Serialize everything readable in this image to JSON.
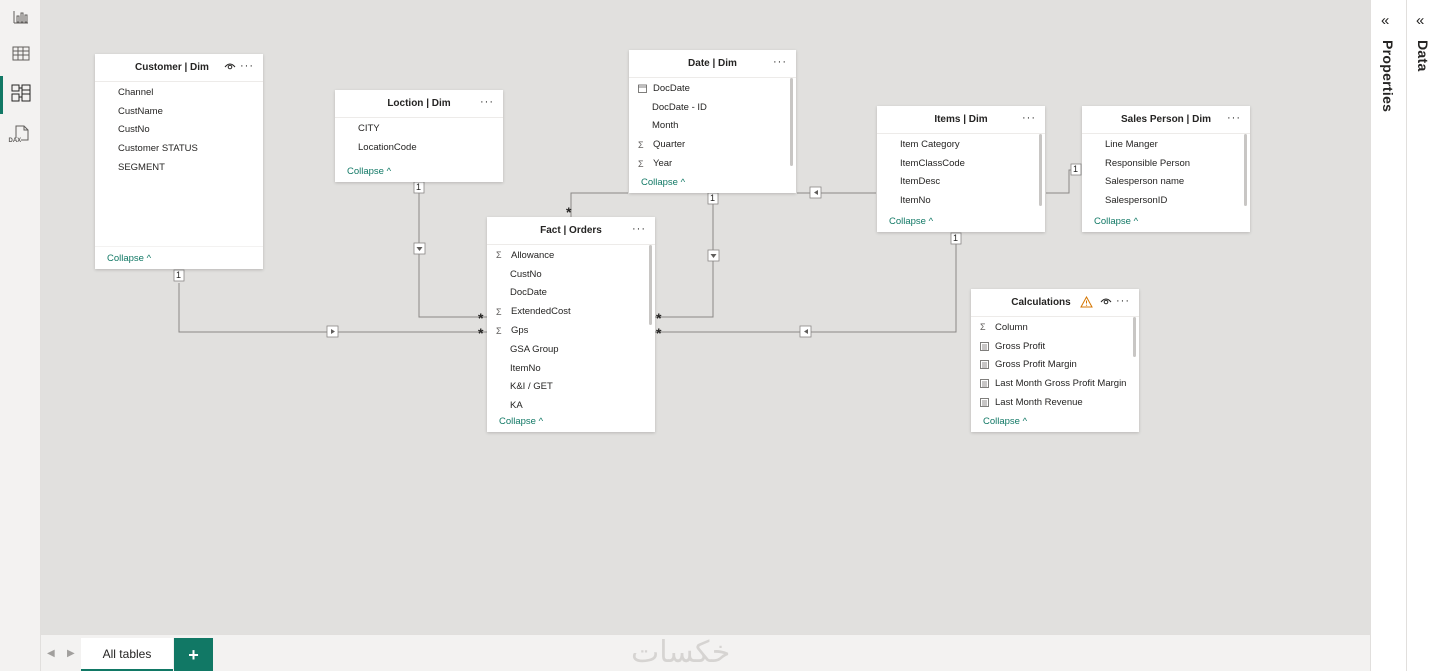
{
  "rail": {
    "items": [
      {
        "icon": "report-view-icon"
      },
      {
        "icon": "table-view-icon"
      },
      {
        "icon": "model-view-icon"
      },
      {
        "icon": "dax-query-view-icon",
        "label": "DAX"
      }
    ]
  },
  "tables": {
    "customer": {
      "title": "Customer | Dim",
      "fields": [
        "Channel",
        "CustName",
        "CustNo",
        "Customer STATUS",
        "SEGMENT"
      ],
      "collapse": "Collapse"
    },
    "location": {
      "title": "Loction | Dim",
      "fields": [
        "CITY",
        "LocationCode"
      ],
      "collapse": "Collapse"
    },
    "date": {
      "title": "Date | Dim",
      "fields": [
        {
          "icon": "calendar",
          "name": "DocDate"
        },
        {
          "icon": "",
          "name": "DocDate - ID"
        },
        {
          "icon": "",
          "name": "Month"
        },
        {
          "icon": "sigma",
          "name": "Quarter"
        },
        {
          "icon": "sigma",
          "name": "Year"
        }
      ],
      "collapse": "Collapse"
    },
    "items": {
      "title": "Items | Dim",
      "fields": [
        "Item Category",
        "ItemClassCode",
        "ItemDesc",
        "ItemNo"
      ],
      "collapse": "Collapse"
    },
    "salesperson": {
      "title": "Sales Person | Dim",
      "fields": [
        "Line Manger",
        "Responsible Person",
        "Salesperson name",
        "SalespersonID"
      ],
      "collapse": "Collapse"
    },
    "fact": {
      "title": "Fact | Orders",
      "fields": [
        {
          "icon": "sigma",
          "name": "Allowance"
        },
        {
          "icon": "",
          "name": "CustNo"
        },
        {
          "icon": "",
          "name": "DocDate"
        },
        {
          "icon": "sigma",
          "name": "ExtendedCost"
        },
        {
          "icon": "sigma",
          "name": "Gps"
        },
        {
          "icon": "",
          "name": "GSA Group"
        },
        {
          "icon": "",
          "name": "ItemNo"
        },
        {
          "icon": "",
          "name": "K&I / GET"
        },
        {
          "icon": "",
          "name": "KA"
        }
      ],
      "collapse": "Collapse"
    },
    "calculations": {
      "title": "Calculations",
      "fields": [
        {
          "icon": "sigma",
          "name": "Column"
        },
        {
          "icon": "calc",
          "name": "Gross Profit"
        },
        {
          "icon": "calc",
          "name": "Gross Profit Margin"
        },
        {
          "icon": "calc",
          "name": "Last Month Gross Profit Margin"
        },
        {
          "icon": "calc",
          "name": "Last Month Revenue"
        }
      ],
      "collapse": "Collapse"
    }
  },
  "relationships": {
    "one": "1",
    "many": "*"
  },
  "panes": {
    "properties": "Properties",
    "data": "Data"
  },
  "bottom": {
    "tab_all": "All tables",
    "add": "+",
    "watermark": "خكسات"
  }
}
